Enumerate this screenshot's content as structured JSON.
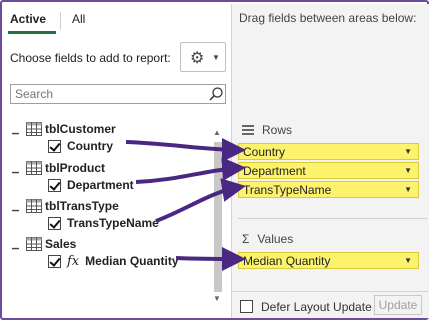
{
  "tabs": {
    "active": "Active",
    "all": "All"
  },
  "choose_label": "Choose fields to add to report:",
  "search": {
    "placeholder": "Search"
  },
  "tree": [
    {
      "table": "tblCustomer",
      "field": "Country",
      "fx": false
    },
    {
      "table": "tblProduct",
      "field": "Department",
      "fx": false
    },
    {
      "table": "tblTransType",
      "field": "TransTypeName",
      "fx": false
    },
    {
      "table": "Sales",
      "field": "Median Quantity",
      "fx": true
    }
  ],
  "fx_symbol": "fx",
  "right": {
    "drag_label": "Drag fields between areas below:",
    "rows_label": "Rows",
    "values_label": "Values",
    "sigma": "Σ",
    "rows": [
      "Country",
      "Department",
      "TransTypeName"
    ],
    "values": [
      "Median Quantity"
    ]
  },
  "footer": {
    "defer_label": "Defer Layout Update",
    "update_label": "Update"
  },
  "colors": {
    "frame": "#6a4c9c",
    "arrow": "#4b2784",
    "highlight": "#fdf26b",
    "active_tab": "#217346"
  },
  "icons": [
    "gear-icon",
    "search-icon",
    "table-icon",
    "rows-icon",
    "sigma-icon",
    "chevron-down-icon",
    "fx-icon",
    "checkbox-icon"
  ]
}
